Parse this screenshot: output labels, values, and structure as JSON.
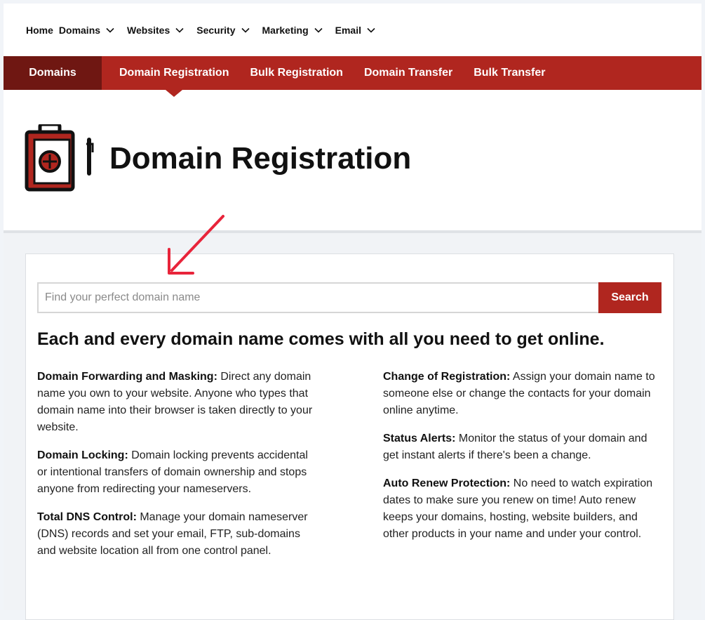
{
  "top_nav": {
    "items": [
      {
        "label": "Home",
        "has_chevron": false
      },
      {
        "label": "Domains",
        "has_chevron": true
      },
      {
        "label": "Websites",
        "has_chevron": true
      },
      {
        "label": "Security",
        "has_chevron": true
      },
      {
        "label": "Marketing",
        "has_chevron": true
      },
      {
        "label": "Email",
        "has_chevron": true
      }
    ]
  },
  "sub_nav": {
    "section_label": "Domains",
    "tabs": [
      {
        "label": "Domain Registration",
        "active": true
      },
      {
        "label": "Bulk Registration",
        "active": false
      },
      {
        "label": "Domain Transfer",
        "active": false
      },
      {
        "label": "Bulk Transfer",
        "active": false
      }
    ]
  },
  "hero": {
    "title": "Domain Registration",
    "icon": "domain-registration-icon"
  },
  "search": {
    "placeholder": "Find your perfect domain name",
    "value": "",
    "button_label": "Search"
  },
  "features": {
    "headline": "Each and every domain name comes with all you need to get online.",
    "left": [
      {
        "title": "Domain Forwarding and Masking:",
        "text": " Direct any domain name you own to your website. Anyone who types that domain name into their browser is taken directly to your website."
      },
      {
        "title": "Domain Locking:",
        "text": " Domain locking prevents accidental or intentional transfers of domain ownership and stops anyone from redirecting your nameservers."
      },
      {
        "title": "Total DNS Control:",
        "text": " Manage your domain nameserver (DNS) records and set your email, FTP, sub-domains and website location all from one control panel."
      }
    ],
    "right": [
      {
        "title": "Change of Registration:",
        "text": " Assign your domain name to someone else or change the contacts for your domain online anytime."
      },
      {
        "title": "Status Alerts:",
        "text": " Monitor the status of your domain and get instant alerts if there's been a change."
      },
      {
        "title": "Auto Renew Protection:",
        "text": " No need to watch expiration dates to make sure you renew on time! Auto renew keeps your domains, hosting, website builders, and other products in your name and under your control."
      }
    ]
  },
  "colors": {
    "brand_red": "#b0261f",
    "dark_red": "#6f1712",
    "annotation_arrow": "#e8243a"
  }
}
